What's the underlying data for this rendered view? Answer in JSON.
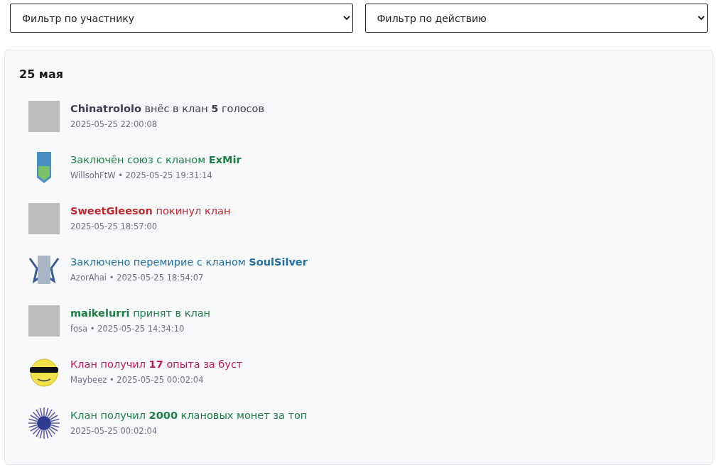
{
  "filters": [
    {
      "placeholder": "Фильтр по участнику"
    },
    {
      "placeholder": "Фильтр по действию"
    }
  ],
  "log": {
    "date": "25 мая",
    "entries": [
      {
        "kind": "skin",
        "color": "#3a3f4b",
        "message": "**Chinatrololo** внёс в клан **5** голосов",
        "meta": "2025-05-25 22:00:08"
      },
      {
        "kind": "banner",
        "color": "#1d7f46",
        "message": "Заключён союз с кланом **ExMir**",
        "meta": "WillsohFtW • 2025-05-25 19:31:14"
      },
      {
        "kind": "skin",
        "color": "#c0262d",
        "message": "**SweetGleeson** покинул клан",
        "meta": "2025-05-25 18:57:00"
      },
      {
        "kind": "emblem",
        "color": "#1f6fa3",
        "message": "Заключено перемирие с кланом **SoulSilver**",
        "meta": "AzorAhai • 2025-05-25 18:54:07"
      },
      {
        "kind": "skin",
        "color": "#1d7f46",
        "message": "**maikelurri** принят в клан",
        "meta": "fosa • 2025-05-25 14:34:10"
      },
      {
        "kind": "smiley",
        "color": "#c2185b",
        "message": "Клан получил **17** опыта за буст",
        "meta": "Maybeez • 2025-05-25 00:02:04"
      },
      {
        "kind": "globe",
        "color": "#1d7f46",
        "message": "Клан получил **2000** клановых монет за топ",
        "meta": "2025-05-25 00:02:04"
      }
    ]
  }
}
